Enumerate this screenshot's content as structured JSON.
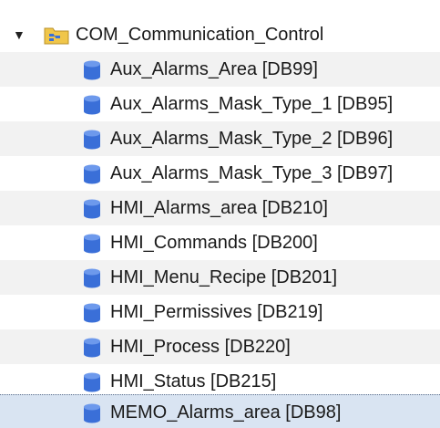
{
  "tree": {
    "folder": {
      "label": "COM_Communication_Control",
      "expanded": true,
      "icon": "program-folder-icon"
    },
    "items": [
      {
        "label": "Aux_Alarms_Area [DB99]",
        "icon": "data-block-icon"
      },
      {
        "label": "Aux_Alarms_Mask_Type_1 [DB95]",
        "icon": "data-block-icon"
      },
      {
        "label": "Aux_Alarms_Mask_Type_2 [DB96]",
        "icon": "data-block-icon"
      },
      {
        "label": "Aux_Alarms_Mask_Type_3 [DB97]",
        "icon": "data-block-icon"
      },
      {
        "label": "HMI_Alarms_area [DB210]",
        "icon": "data-block-icon"
      },
      {
        "label": "HMI_Commands [DB200]",
        "icon": "data-block-icon"
      },
      {
        "label": "HMI_Menu_Recipe [DB201]",
        "icon": "data-block-icon"
      },
      {
        "label": "HMI_Permissives [DB219]",
        "icon": "data-block-icon"
      },
      {
        "label": "HMI_Process [DB220]",
        "icon": "data-block-icon"
      },
      {
        "label": "HMI_Status [DB215]",
        "icon": "data-block-icon"
      },
      {
        "label": "MEMO_Alarms_area [DB98]",
        "icon": "data-block-icon",
        "selected": true
      }
    ],
    "colors": {
      "alt_row": "#f2f2f2",
      "selected_row": "#d9e4f2",
      "db_icon": "#3a6fd8",
      "folder": "#f0c64a"
    }
  }
}
